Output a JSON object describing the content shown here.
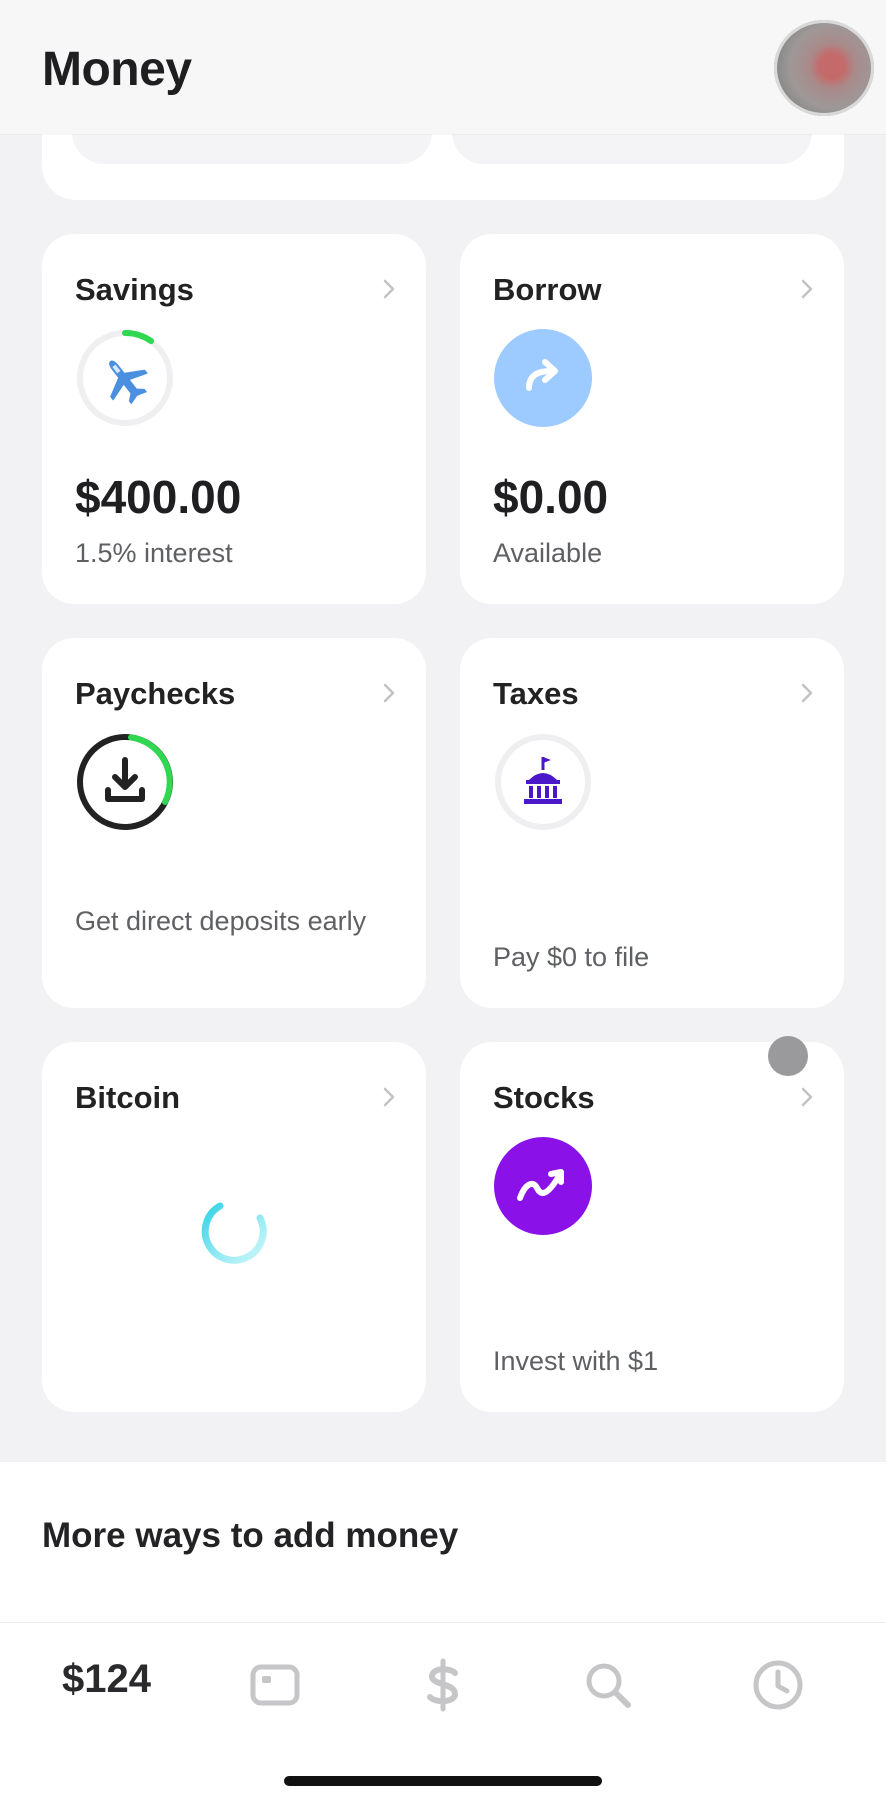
{
  "header": {
    "title": "Money"
  },
  "cards": {
    "savings": {
      "title": "Savings",
      "value": "$400.00",
      "subtitle": "1.5% interest",
      "icon": "airplane-icon",
      "progress": 0.12
    },
    "borrow": {
      "title": "Borrow",
      "value": "$0.00",
      "subtitle": "Available",
      "icon": "arrow-forward-icon"
    },
    "paychecks": {
      "title": "Paychecks",
      "subtitle": "Get direct deposits early",
      "icon": "download-icon",
      "progress": 0.3
    },
    "taxes": {
      "title": "Taxes",
      "subtitle": "Pay $0 to file",
      "icon": "government-building-icon"
    },
    "bitcoin": {
      "title": "Bitcoin",
      "icon": "loading-spinner-icon"
    },
    "stocks": {
      "title": "Stocks",
      "subtitle": "Invest with $1",
      "icon": "stock-trend-icon"
    }
  },
  "more": {
    "title": "More ways to add money"
  },
  "tabbar": {
    "balance": "$124",
    "items": [
      "card-icon",
      "dollar-icon",
      "search-icon",
      "clock-icon"
    ]
  },
  "colors": {
    "background": "#f2f2f4",
    "card": "#ffffff",
    "green": "#2fd84f",
    "borrow_blue": "#9ecbff",
    "stocks_purple": "#8a11e8",
    "taxes_purple": "#4a18c8",
    "bitcoin_spinner": "#2fd2e6"
  }
}
